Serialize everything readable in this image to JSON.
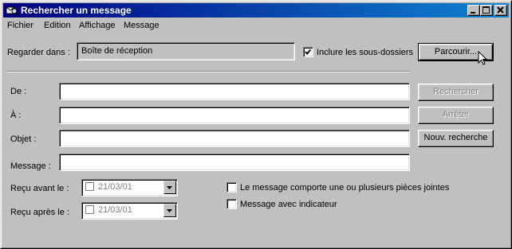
{
  "window": {
    "title": "Rechercher un message",
    "icon": "find-message-icon"
  },
  "menu": {
    "items": [
      "Fichier",
      "Edition",
      "Affichage",
      "Message"
    ]
  },
  "lookin": {
    "label": "Regarder dans :",
    "value": "Boîte de réception",
    "subfolders_label": "Inclure les sous-dossiers",
    "subfolders_checked": true,
    "browse_label": "Parcourir..."
  },
  "fields": {
    "from_label": "De :",
    "to_label": "À :",
    "subject_label": "Objet :",
    "message_label": "Message :",
    "from_value": "",
    "to_value": "",
    "subject_value": "",
    "message_value": ""
  },
  "buttons": {
    "search": "Rechercher",
    "stop": "Arrêter",
    "new_search": "Nouv. recherche"
  },
  "dates": {
    "before_label": "Reçu avant le :",
    "before_value": "21/03/01",
    "before_checked": false,
    "after_label": "Reçu après le :",
    "after_value": "21/03/01",
    "after_checked": false
  },
  "options": {
    "attachments_label": "Le message comporte une ou plusieurs pièces jointes",
    "attachments_checked": false,
    "flagged_label": "Message avec indicateur",
    "flagged_checked": false
  },
  "colors": {
    "title_start": "#000080",
    "title_end": "#1084d0",
    "face": "#c0c0c0"
  }
}
